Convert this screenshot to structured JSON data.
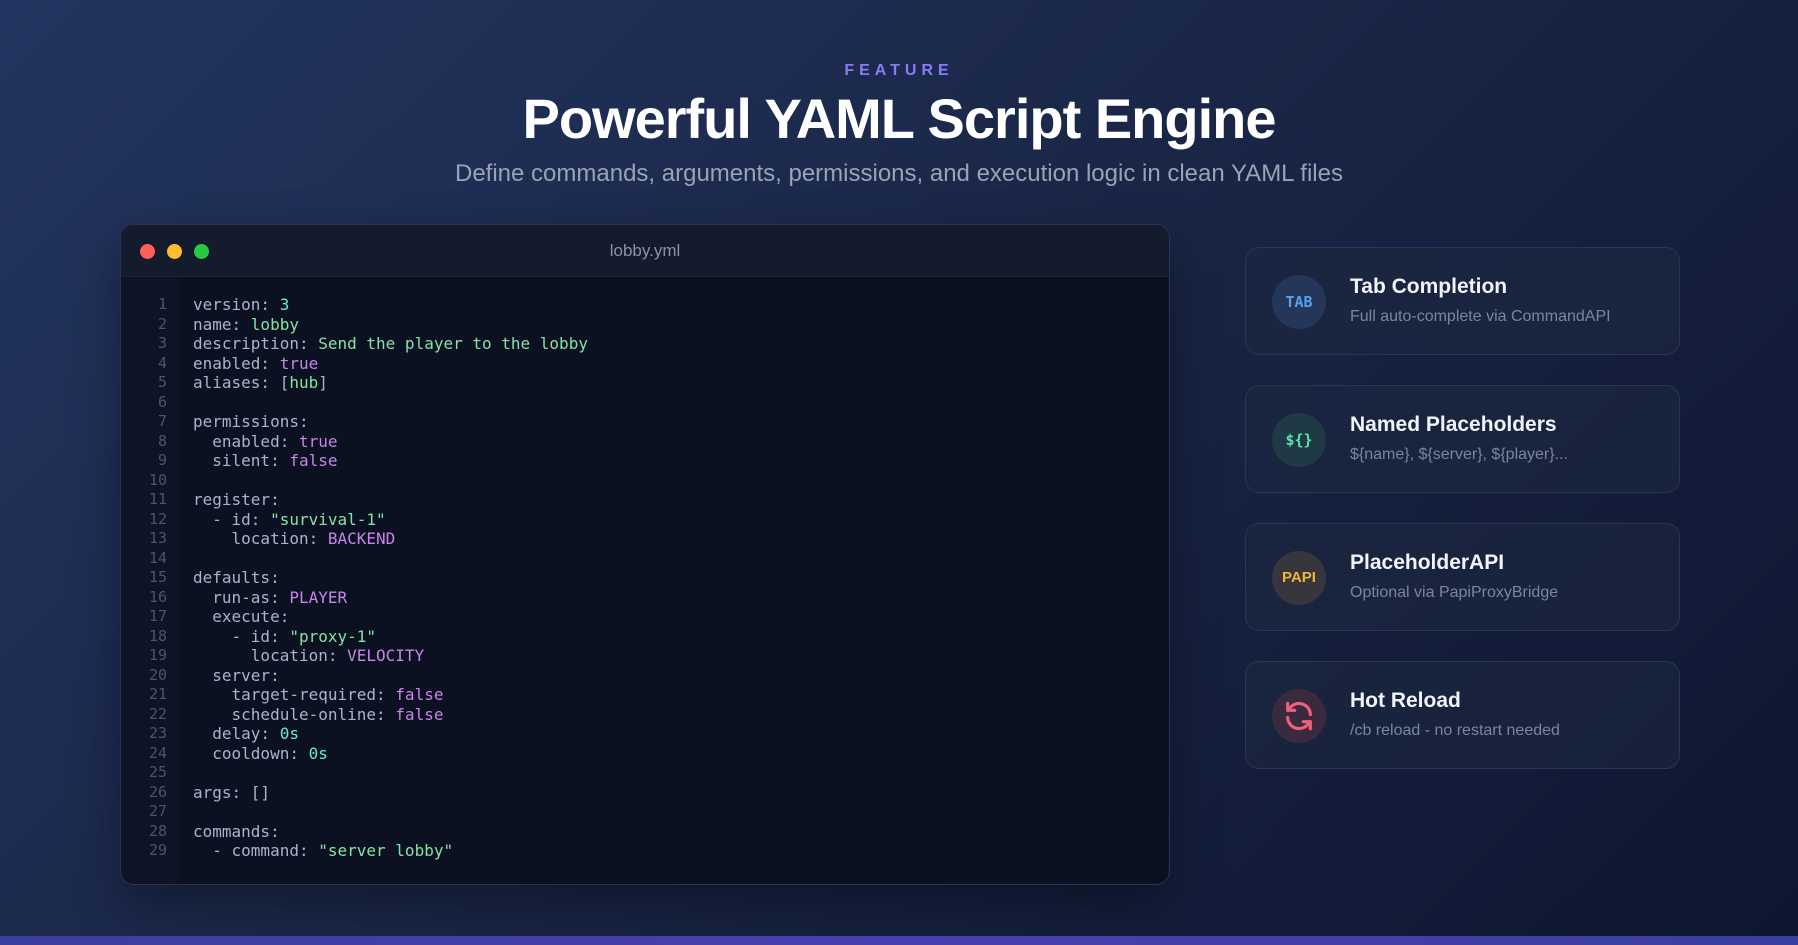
{
  "header": {
    "eyebrow": "FEATURE",
    "title": "Powerful YAML Script Engine",
    "subtitle": "Define commands, arguments, permissions, and execution logic in clean YAML files"
  },
  "editor": {
    "filename": "lobby.yml",
    "lines": [
      {
        "n": "1",
        "parts": [
          {
            "t": "version: ",
            "c": "k"
          },
          {
            "t": "3",
            "c": "n"
          }
        ]
      },
      {
        "n": "2",
        "parts": [
          {
            "t": "name: ",
            "c": "k"
          },
          {
            "t": "lobby",
            "c": "s"
          }
        ]
      },
      {
        "n": "3",
        "parts": [
          {
            "t": "description: ",
            "c": "k"
          },
          {
            "t": "Send the player to the lobby",
            "c": "s"
          }
        ]
      },
      {
        "n": "4",
        "parts": [
          {
            "t": "enabled: ",
            "c": "k"
          },
          {
            "t": "true",
            "c": "b"
          }
        ]
      },
      {
        "n": "5",
        "parts": [
          {
            "t": "aliases: ",
            "c": "k"
          },
          {
            "t": "[",
            "c": "p"
          },
          {
            "t": "hub",
            "c": "s"
          },
          {
            "t": "]",
            "c": "p"
          }
        ]
      },
      {
        "n": "6",
        "parts": []
      },
      {
        "n": "7",
        "parts": [
          {
            "t": "permissions:",
            "c": "k"
          }
        ]
      },
      {
        "n": "8",
        "parts": [
          {
            "t": "  enabled: ",
            "c": "k"
          },
          {
            "t": "true",
            "c": "b"
          }
        ]
      },
      {
        "n": "9",
        "parts": [
          {
            "t": "  silent: ",
            "c": "k"
          },
          {
            "t": "false",
            "c": "b"
          }
        ]
      },
      {
        "n": "10",
        "parts": []
      },
      {
        "n": "11",
        "parts": [
          {
            "t": "register:",
            "c": "k"
          }
        ]
      },
      {
        "n": "12",
        "parts": [
          {
            "t": "  - id: ",
            "c": "k"
          },
          {
            "t": "\"survival-1\"",
            "c": "s"
          }
        ]
      },
      {
        "n": "13",
        "parts": [
          {
            "t": "    location: ",
            "c": "k"
          },
          {
            "t": "BACKEND",
            "c": "e"
          }
        ]
      },
      {
        "n": "14",
        "parts": []
      },
      {
        "n": "15",
        "parts": [
          {
            "t": "defaults:",
            "c": "k"
          }
        ]
      },
      {
        "n": "16",
        "parts": [
          {
            "t": "  run-as: ",
            "c": "k"
          },
          {
            "t": "PLAYER",
            "c": "e"
          }
        ]
      },
      {
        "n": "17",
        "parts": [
          {
            "t": "  execute:",
            "c": "k"
          }
        ]
      },
      {
        "n": "18",
        "parts": [
          {
            "t": "    - id: ",
            "c": "k"
          },
          {
            "t": "\"proxy-1\"",
            "c": "s"
          }
        ]
      },
      {
        "n": "19",
        "parts": [
          {
            "t": "      location: ",
            "c": "k"
          },
          {
            "t": "VELOCITY",
            "c": "e"
          }
        ]
      },
      {
        "n": "20",
        "parts": [
          {
            "t": "  server:",
            "c": "k"
          }
        ]
      },
      {
        "n": "21",
        "parts": [
          {
            "t": "    target-required: ",
            "c": "k"
          },
          {
            "t": "false",
            "c": "b"
          }
        ]
      },
      {
        "n": "22",
        "parts": [
          {
            "t": "    schedule-online: ",
            "c": "k"
          },
          {
            "t": "false",
            "c": "b"
          }
        ]
      },
      {
        "n": "23",
        "parts": [
          {
            "t": "  delay: ",
            "c": "k"
          },
          {
            "t": "0s",
            "c": "n"
          }
        ]
      },
      {
        "n": "24",
        "parts": [
          {
            "t": "  cooldown: ",
            "c": "k"
          },
          {
            "t": "0s",
            "c": "n"
          }
        ]
      },
      {
        "n": "25",
        "parts": []
      },
      {
        "n": "26",
        "parts": [
          {
            "t": "args: ",
            "c": "k"
          },
          {
            "t": "[]",
            "c": "p"
          }
        ]
      },
      {
        "n": "27",
        "parts": []
      },
      {
        "n": "28",
        "parts": [
          {
            "t": "commands:",
            "c": "k"
          }
        ]
      },
      {
        "n": "29",
        "parts": [
          {
            "t": "  - command: ",
            "c": "k"
          },
          {
            "t": "\"server lobby\"",
            "c": "s"
          }
        ]
      }
    ]
  },
  "features": [
    {
      "badge": "TAB",
      "badge_color": "#5aa0f0",
      "badge_bg": "#24365a",
      "icon": "tab-icon",
      "title": "Tab Completion",
      "desc": "Full auto-complete via CommandAPI"
    },
    {
      "badge": "${}",
      "badge_color": "#5ee0b0",
      "badge_bg": "#1f3a44",
      "icon": "braces-icon",
      "title": "Named Placeholders",
      "desc": "${name}, ${server}, ${player}..."
    },
    {
      "badge": "PAPI",
      "badge_color": "#f2b53a",
      "badge_bg": "#37363d",
      "icon": "papi-icon",
      "title": "PlaceholderAPI",
      "desc": "Optional via PapiProxyBridge"
    },
    {
      "badge": "",
      "badge_color": "#f0607a",
      "badge_bg": "#3a2a3e",
      "icon": "refresh-icon",
      "title": "Hot Reload",
      "desc": "/cb reload - no restart needed"
    }
  ]
}
